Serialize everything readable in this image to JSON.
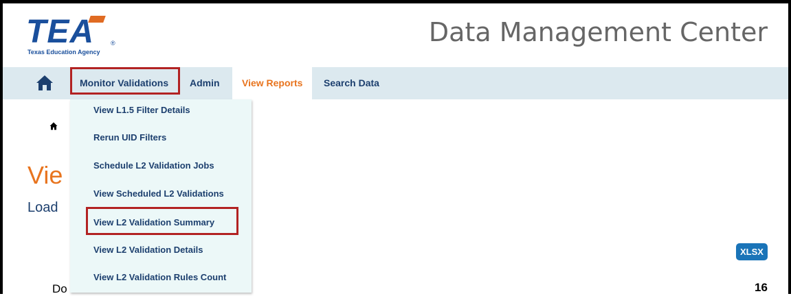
{
  "logo": {
    "text": "TEA",
    "subtitle": "Texas Education Agency",
    "registered": "®"
  },
  "header": {
    "site_title": "Data Management Center"
  },
  "nav": {
    "home_icon": "home-icon",
    "items": [
      {
        "label": "Monitor Validations"
      },
      {
        "label": "Admin"
      },
      {
        "label": "View Reports"
      },
      {
        "label": "Search Data"
      }
    ]
  },
  "dropdown": {
    "items": [
      {
        "label": "View L1.5 Filter Details"
      },
      {
        "label": "Rerun UID Filters"
      },
      {
        "label": "Schedule L2 Validation Jobs"
      },
      {
        "label": "View Scheduled L2 Validations"
      },
      {
        "label": "View L2 Validation Summary"
      },
      {
        "label": "View L2 Validation Details"
      },
      {
        "label": "View L2 Validation Rules Count"
      }
    ]
  },
  "page": {
    "breadcrumb_icon": "home-icon",
    "heading_partial": "Vie",
    "subheading_partial": "Load",
    "export_button": "XLSX",
    "domains_partial": "Do",
    "count": "16"
  },
  "colors": {
    "nav_background": "#dce9ef",
    "accent_orange": "#e8741e",
    "navy": "#1c3f6e",
    "highlight_red": "#b22222",
    "dropdown_background": "#ecf8f8",
    "button_blue": "#1a74b8"
  }
}
